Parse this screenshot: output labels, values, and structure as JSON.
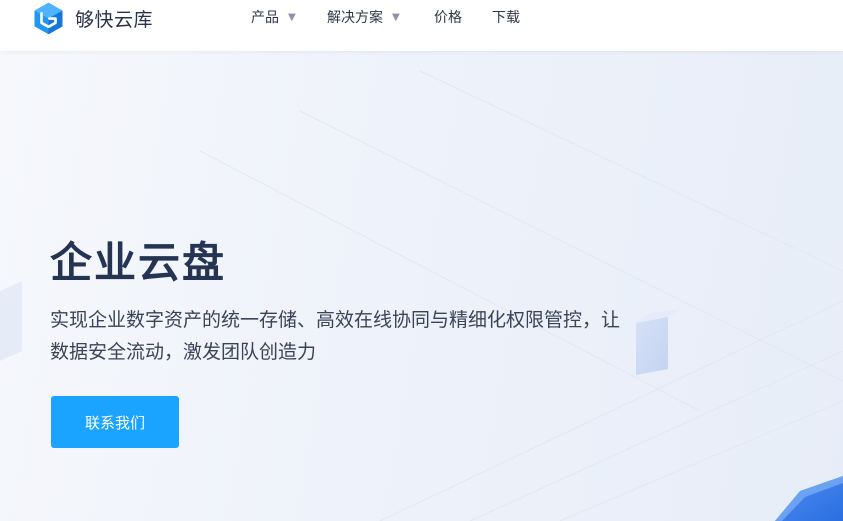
{
  "brand": {
    "name": "够快云库",
    "logo_icon": "cube-logo-icon",
    "accent": "#1aa3ff"
  },
  "nav": {
    "items": [
      {
        "label": "产品",
        "has_dropdown": true
      },
      {
        "label": "解决方案",
        "has_dropdown": true
      },
      {
        "label": "价格",
        "has_dropdown": false
      },
      {
        "label": "下载",
        "has_dropdown": false
      }
    ],
    "dropdown_icon": "caret-down-icon",
    "caret": "▼"
  },
  "hero": {
    "title": "企业云盘",
    "description_line1": "实现企业数字资产的统一存储、高效在线协同与精细化权限管控，让",
    "description_line2": "数据安全流动，激发团队创造力",
    "cta_label": "联系我们"
  },
  "colors": {
    "title": "#243452",
    "text": "#3a4457",
    "button": "#1aa3ff",
    "button_text": "#ffffff"
  }
}
